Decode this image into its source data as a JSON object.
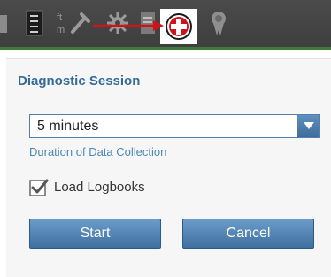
{
  "toolbar": {
    "icons": [
      "app-partial-icon",
      "clipboard-icon",
      "ft-m-units-wrench-icon",
      "gear-icon",
      "document-icon",
      "diagnostic-red-cross-icon",
      "award-badge-icon"
    ],
    "accent_color": "#d0121b",
    "units_top": "ft",
    "units_bottom": "m"
  },
  "panel": {
    "title": "Diagnostic Session",
    "duration_select": {
      "value": "5 minutes",
      "caption": "Duration of Data Collection"
    },
    "load_logbooks": {
      "label": "Load Logbooks",
      "checked": true
    },
    "start_label": "Start",
    "cancel_label": "Cancel"
  },
  "colors": {
    "title": "#356b97",
    "button": "#4f80ae",
    "caption": "#4a88b7",
    "toolbar": "#444444",
    "toolbar_accent": "#3e7b3a"
  }
}
